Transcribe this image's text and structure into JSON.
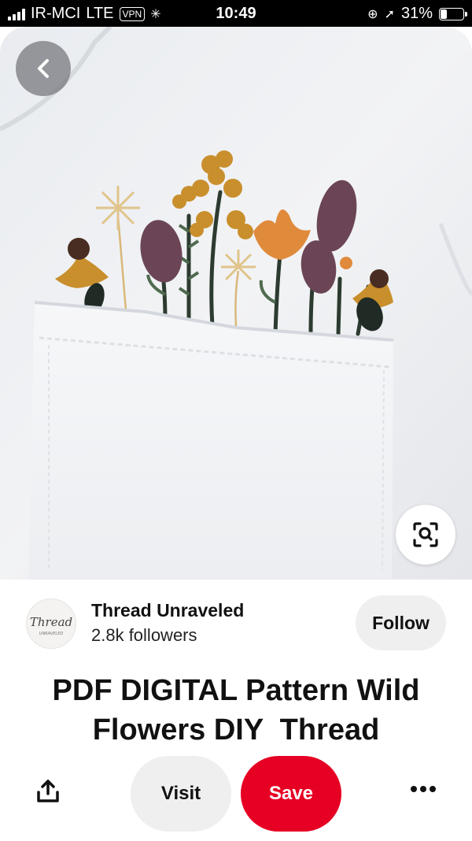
{
  "status_bar": {
    "carrier": "IR-MCI",
    "network": "LTE",
    "vpn": "VPN",
    "time": "10:49",
    "battery": "31%",
    "battery_level": 0.31
  },
  "pin": {
    "image_alt": "Embroidered wild flowers on white t-shirt pocket",
    "creator": {
      "name": "Thread Unraveled",
      "followers": "2.8k followers",
      "avatar_script": "Thread",
      "avatar_subtext": "UNRAVELED"
    },
    "follow_label": "Follow",
    "title_line1": "PDF DIGITAL Pattern Wild",
    "title_line2": "Flowers DIY  Thread"
  },
  "actions": {
    "visit_label": "Visit",
    "save_label": "Save"
  },
  "icons": {
    "back": "chevron-left-icon",
    "lens": "visual-search-icon",
    "share": "share-icon",
    "more": "more-icon"
  },
  "colors": {
    "save": "#e60023",
    "visit": "#efefef",
    "follow": "#efefef"
  }
}
